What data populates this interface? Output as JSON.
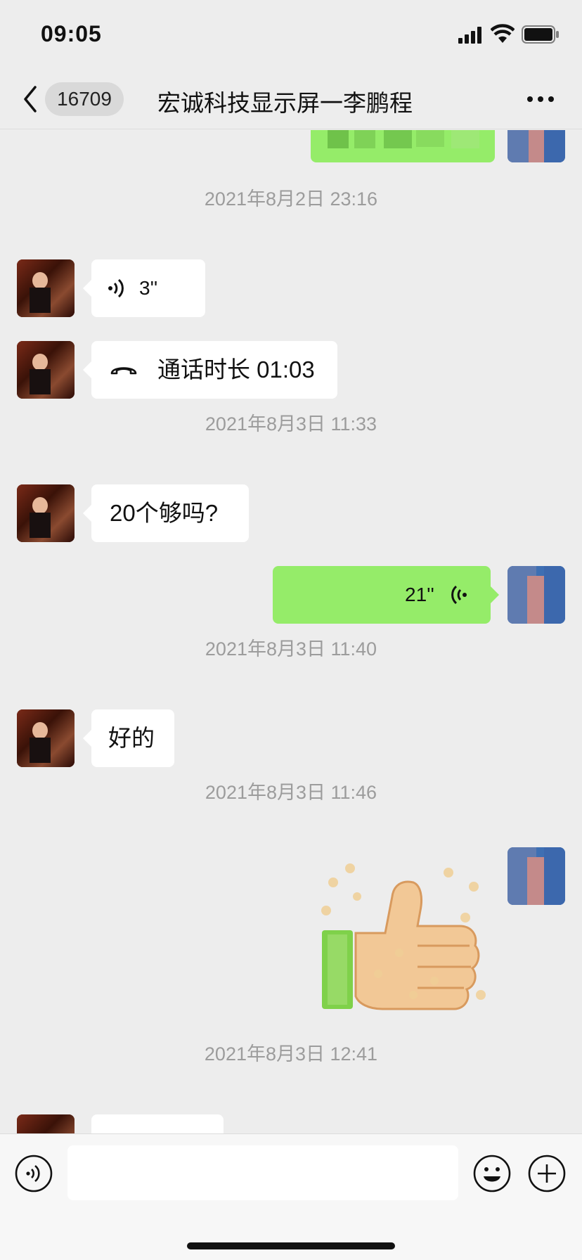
{
  "status_bar": {
    "time": "09:05"
  },
  "nav": {
    "unread_count": "16709",
    "title": "宏诚科技显示屏一李鹏程"
  },
  "messages": [
    {
      "type": "image",
      "sender": "self",
      "content": "pixelated green message (obscured)"
    },
    {
      "type": "timestamp",
      "text": "2021年8月2日 23:16"
    },
    {
      "type": "voice",
      "sender": "peer",
      "duration": "3''",
      "icon": "voice-wave-icon"
    },
    {
      "type": "call",
      "sender": "peer",
      "text": "通话时长 01:03",
      "icon": "phone-hangup-icon"
    },
    {
      "type": "timestamp",
      "text": "2021年8月3日 11:33"
    },
    {
      "type": "text",
      "sender": "peer",
      "text": "20个够吗?"
    },
    {
      "type": "voice",
      "sender": "self",
      "duration": "21''",
      "icon": "voice-wave-icon"
    },
    {
      "type": "timestamp",
      "text": "2021年8月3日 11:40"
    },
    {
      "type": "text",
      "sender": "peer",
      "text": "好的"
    },
    {
      "type": "timestamp",
      "text": "2021年8月3日 11:46"
    },
    {
      "type": "sticker",
      "sender": "self",
      "icon": "thumbs-up-sticker"
    },
    {
      "type": "timestamp",
      "text": "2021年8月3日 12:41"
    },
    {
      "type": "text",
      "sender": "peer",
      "text": ""
    }
  ],
  "colors": {
    "background": "#ededed",
    "outgoing_bubble": "#95ec69",
    "incoming_bubble": "#ffffff",
    "timestamp": "#9c9c9c"
  },
  "input_bar": {
    "value": "",
    "placeholder": ""
  }
}
